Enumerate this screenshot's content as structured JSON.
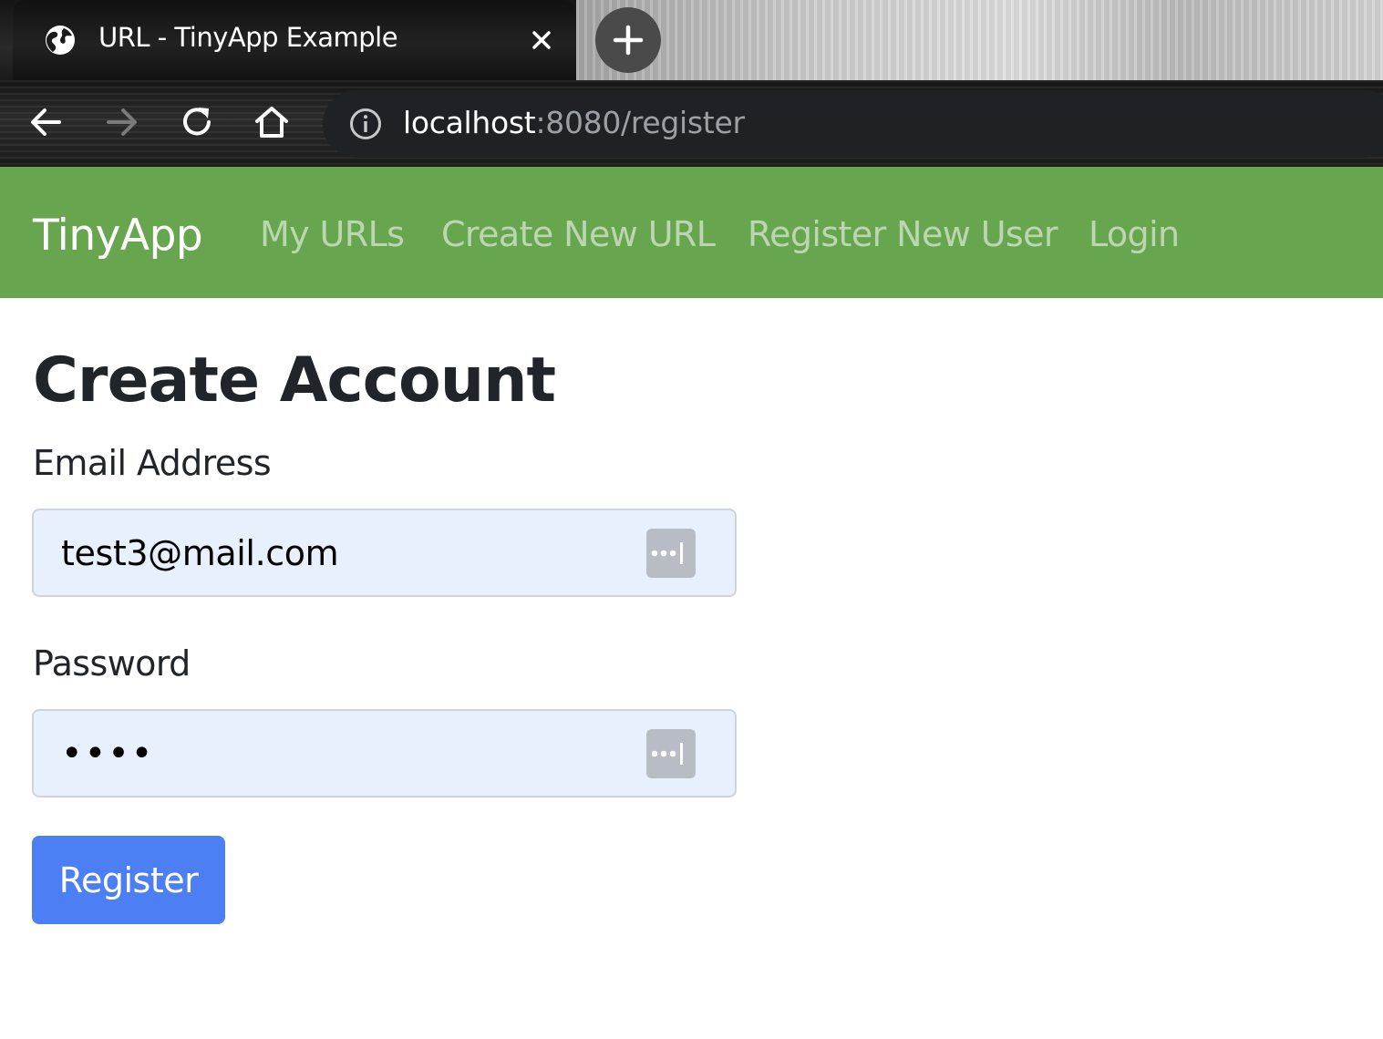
{
  "browser": {
    "tab": {
      "title": "URL - TinyApp Example",
      "favicon_icon": "globe-icon",
      "close_icon": "close-icon"
    },
    "new_tab_icon": "plus-icon",
    "toolbar": {
      "back_icon": "back-arrow-icon",
      "forward_icon": "forward-arrow-icon",
      "reload_icon": "reload-icon",
      "home_icon": "home-icon"
    },
    "omnibox": {
      "site_info_icon": "info-icon",
      "url_host": "localhost",
      "url_rest": ":8080/register"
    }
  },
  "navbar": {
    "brand": "TinyApp",
    "links": [
      {
        "label": "My URLs"
      },
      {
        "label": "Create New URL"
      },
      {
        "label": "Register New User"
      },
      {
        "label": "Login"
      }
    ],
    "bg_color": "#67a64e"
  },
  "form": {
    "heading": "Create Account",
    "email": {
      "label": "Email Address",
      "value": "test3@mail.com"
    },
    "password": {
      "label": "Password",
      "value": "••••"
    },
    "password_manager_icon": "password-manager-icon",
    "submit_label": "Register",
    "submit_color": "#4c7ff4",
    "autofill_bg": "#e8f0fe"
  }
}
